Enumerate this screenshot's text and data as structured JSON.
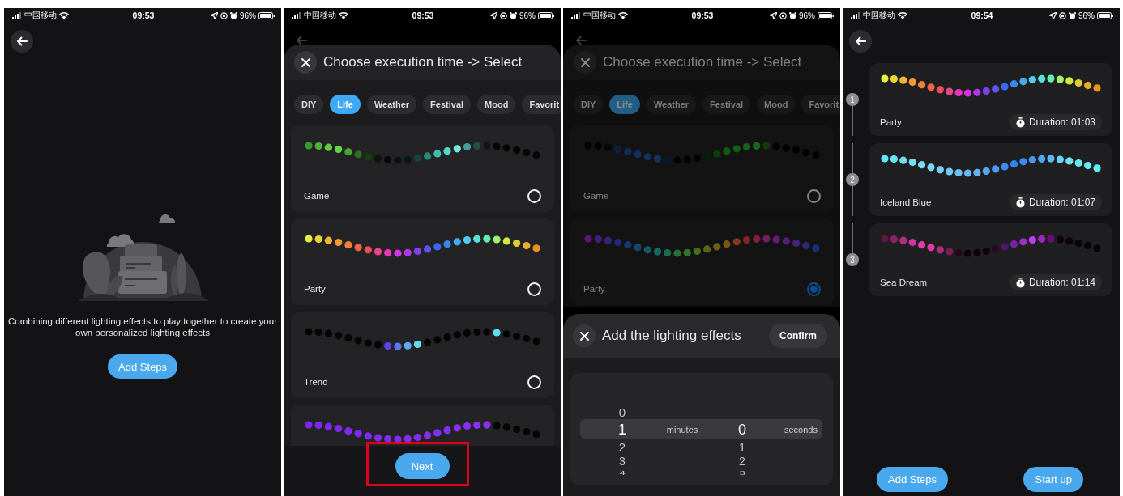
{
  "screens": [
    {
      "kind": "empty",
      "status_bar": {
        "carrier": "中国移动",
        "time": "09:53",
        "battery": "96%"
      },
      "back_button": {
        "dimmed": false
      },
      "message": "Combining different lighting effects to play together to create your own personalized lighting effects",
      "button": "Add Steps"
    },
    {
      "kind": "select",
      "status_bar": {
        "carrier": "中国移动",
        "time": "09:53",
        "battery": "96%"
      },
      "back_button": {
        "dimmed": true
      },
      "sheet": {
        "dimmed": false,
        "title": "Choose execution time -> Select",
        "tabs": [
          {
            "label": "DIY",
            "selected": false
          },
          {
            "label": "Life",
            "selected": true
          },
          {
            "label": "Weather",
            "selected": false
          },
          {
            "label": "Festival",
            "selected": false
          },
          {
            "label": "Mood",
            "selected": false
          },
          {
            "label": "Favorit",
            "selected": false
          }
        ],
        "effects": [
          {
            "name": "Game",
            "selected": false,
            "cut_off": false
          },
          {
            "name": "Party",
            "selected": false,
            "cut_off": false
          },
          {
            "name": "Trend",
            "selected": false,
            "cut_off": false
          },
          {
            "cut_off": true
          }
        ]
      },
      "next_button": {
        "label": "Next",
        "highlighted": true
      }
    },
    {
      "kind": "picker",
      "status_bar": {
        "carrier": "中国移动",
        "time": "09:53",
        "battery": "96%"
      },
      "back_button": {
        "dimmed": true
      },
      "sheet": {
        "dimmed": true,
        "title": "Choose execution time -> Select",
        "tabs": [
          {
            "label": "DIY",
            "selected": false
          },
          {
            "label": "Life",
            "selected": true
          },
          {
            "label": "Weather",
            "selected": false
          },
          {
            "label": "Festival",
            "selected": false
          },
          {
            "label": "Mood",
            "selected": false
          },
          {
            "label": "Favorit",
            "selected": false
          }
        ],
        "effects": [
          {
            "name": "Game",
            "selected": false,
            "cut_off": false
          },
          {
            "name": "Party",
            "selected": true,
            "cut_off": false
          }
        ]
      },
      "dialog": {
        "title": "Add the lighting effects",
        "confirm": "Confirm",
        "columns": [
          {
            "label": "minutes",
            "values": [
              {
                "value": "0",
                "selected": false
              },
              {
                "value": "1",
                "selected": true
              },
              {
                "value": "2",
                "selected": false
              },
              {
                "value": "3",
                "selected": false
              },
              {
                "value": "4",
                "selected": false
              }
            ]
          },
          {
            "label": "seconds",
            "values": [
              {
                "value": "0",
                "selected": true
              },
              {
                "value": "1",
                "selected": false
              },
              {
                "value": "2",
                "selected": false
              },
              {
                "value": "3",
                "selected": false
              }
            ]
          }
        ]
      }
    },
    {
      "kind": "steps",
      "status_bar": {
        "carrier": "中国移动",
        "time": "09:54",
        "battery": "96%"
      },
      "back_button": {
        "dimmed": false
      },
      "steps": [
        {
          "number": "1",
          "name": "Party",
          "duration": "Duration: 01:03"
        },
        {
          "number": "2",
          "name": "Iceland Blue",
          "duration": "Duration: 01:07"
        },
        {
          "number": "3",
          "name": "Sea Dream",
          "duration": "Duration: 01:14"
        }
      ],
      "buttons": [
        "Add Steps",
        "Start up"
      ]
    }
  ]
}
